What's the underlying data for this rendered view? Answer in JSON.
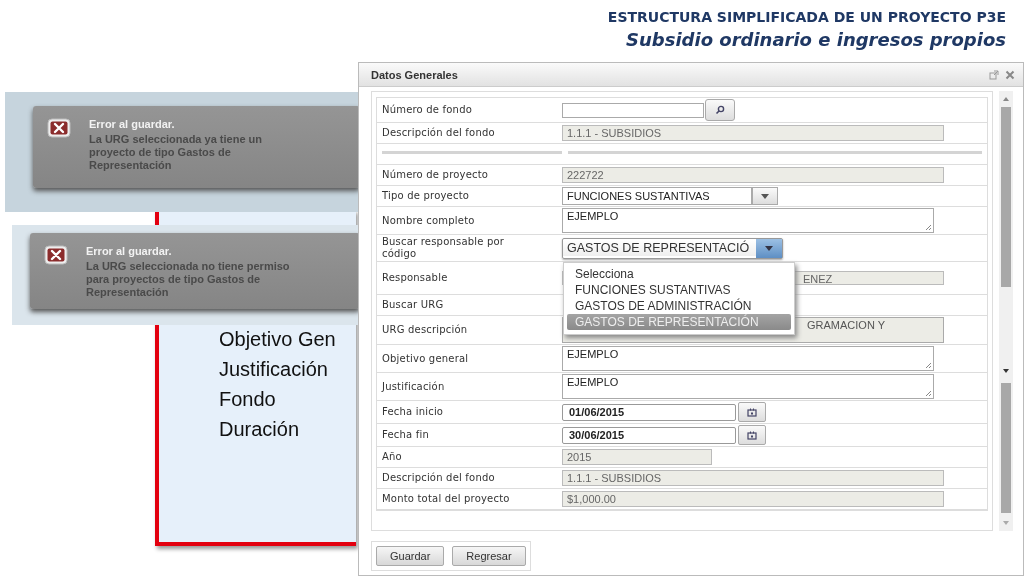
{
  "slide": {
    "heading": "ESTRUCTURA SIMPLIFICADA DE UN PROYECTO P3E",
    "subheading": "Subsidio ordinario e ingresos propios",
    "list": [
      "Objetivo Gen",
      "Justificación",
      "Fondo",
      "Duración"
    ]
  },
  "toasts": [
    {
      "title": "Error al guardar.",
      "message": "La URG seleccionada ya tiene un proyecto de tipo Gastos de Representación"
    },
    {
      "title": "Error al guardar.",
      "message": "La URG seleccionada no tiene permiso para proyectos de tipo Gastos de Representación"
    }
  ],
  "dialog": {
    "title": "Datos Generales",
    "rows": [
      {
        "kind": "search",
        "label": "Número de fondo"
      },
      {
        "kind": "readonly",
        "label": "Descripción del fondo",
        "value": "1.1.1 - SUBSIDIOS"
      },
      {
        "kind": "divider"
      },
      {
        "kind": "readonly",
        "label": "Número de proyecto",
        "value": "222722"
      },
      {
        "kind": "select",
        "label": "Tipo de proyecto",
        "value": "FUNCIONES SUSTANTIVAS"
      },
      {
        "kind": "textarea",
        "label": "Nombre completo",
        "value": "EJEMPLO"
      },
      {
        "kind": "combo",
        "label": "Buscar responsable por código",
        "value": "GASTOS DE REPRESENTACIÓ"
      },
      {
        "kind": "covered",
        "label": "Responsable",
        "value": "ENEZ"
      },
      {
        "kind": "blank",
        "label": "Buscar URG"
      },
      {
        "kind": "covered_textarea",
        "label": "URG descripción",
        "lines": [
          "GRAMACION Y"
        ]
      },
      {
        "kind": "textarea",
        "label": "Objetivo general",
        "value": "EJEMPLO"
      },
      {
        "kind": "textarea",
        "label": "Justificación",
        "value": "EJEMPLO"
      },
      {
        "kind": "date",
        "label": "Fecha inicio",
        "value": "01/06/2015"
      },
      {
        "kind": "date",
        "label": "Fecha fin",
        "value": "30/06/2015"
      },
      {
        "kind": "readonly_short",
        "label": "Año",
        "value": "2015"
      },
      {
        "kind": "readonly",
        "label": "Descripción del fondo",
        "value": "1.1.1 - SUBSIDIOS"
      },
      {
        "kind": "readonly",
        "label": "Monto total del proyecto",
        "value": "$1,000.00"
      }
    ],
    "dropdown": [
      {
        "label": "Selecciona",
        "selected": false
      },
      {
        "label": "FUNCIONES SUSTANTIVAS",
        "selected": false
      },
      {
        "label": "GASTOS DE ADMINISTRACIÓN",
        "selected": false
      },
      {
        "label": "GASTOS DE REPRESENTACIÓN",
        "selected": true
      }
    ],
    "buttons": [
      "Guardar",
      "Regresar"
    ]
  }
}
